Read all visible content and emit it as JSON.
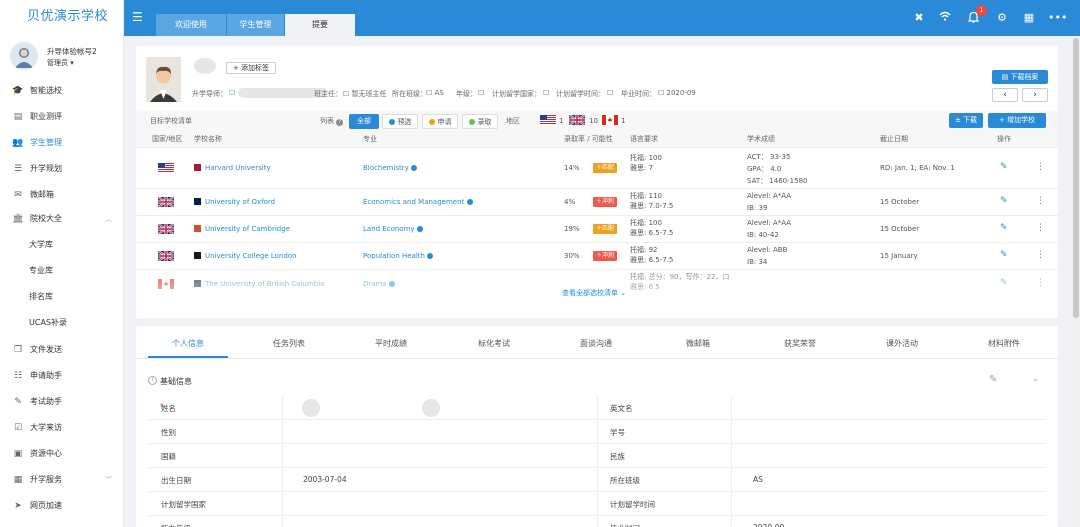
{
  "app": {
    "brand": "贝优演示学校"
  },
  "user": {
    "name": "升导体验帐号2",
    "role": "管理员 ▾"
  },
  "sidebar": {
    "items": [
      {
        "label": "智能选校",
        "icon": "graduation-cap-icon",
        "glyph": "🎓"
      },
      {
        "label": "职业测评",
        "icon": "clipboard-icon",
        "glyph": "▤"
      },
      {
        "label": "学生管理",
        "icon": "users-icon",
        "glyph": "👥"
      },
      {
        "label": "升学规划",
        "icon": "list-icon",
        "glyph": "☰"
      },
      {
        "label": "微邮箱",
        "icon": "mail-icon",
        "glyph": "✉"
      },
      {
        "label": "院校大全",
        "icon": "institution-icon",
        "glyph": "🏛"
      },
      {
        "label": "大学库",
        "icon": "",
        "glyph": ""
      },
      {
        "label": "专业库",
        "icon": "",
        "glyph": ""
      },
      {
        "label": "排名库",
        "icon": "",
        "glyph": ""
      },
      {
        "label": "UCAS补录",
        "icon": "",
        "glyph": ""
      },
      {
        "label": "文件发送",
        "icon": "file-copy-icon",
        "glyph": "❐"
      },
      {
        "label": "申请助手",
        "icon": "list-grid-icon",
        "glyph": "☷"
      },
      {
        "label": "考试助手",
        "icon": "edit-icon",
        "glyph": "✎"
      },
      {
        "label": "大学来访",
        "icon": "calendar-check-icon",
        "glyph": "☑"
      },
      {
        "label": "资源中心",
        "icon": "folder-icon",
        "glyph": "▣"
      },
      {
        "label": "升学服务",
        "icon": "grid-icon",
        "glyph": "▦"
      },
      {
        "label": "网页加速",
        "icon": "send-icon",
        "glyph": "➤"
      }
    ]
  },
  "topbar": {
    "tabs": [
      "欢迎使用",
      "学生管理",
      "提要"
    ],
    "bell_count": "1"
  },
  "profile": {
    "add_tag": "+ 添加标签",
    "download_button": "下载档案",
    "meta": {
      "advisor_label": "升学导师：",
      "teacher_label": "班主任：",
      "teacher_value": "暂无班主任",
      "class_label": "所在班级：",
      "class_value": "AS",
      "grade_label": "年级：",
      "country_label": "计划留学国家：",
      "time_label": "计划留学时间：",
      "grad_label": "毕业时间：",
      "grad_value": "2020-09"
    }
  },
  "schools": {
    "title": "目标学校清单",
    "list_label": "列表",
    "filters": [
      "全部",
      "预选",
      "申请",
      "录取"
    ],
    "filter_colors": [
      "#2a8ad8",
      "#f0a020",
      "#6cc24a"
    ],
    "region_label": "地区",
    "region_counts": [
      "1",
      "10",
      "1"
    ],
    "download": "± 下载",
    "add": "+ 增加学校",
    "headers": [
      "国家/地区",
      "学校名称",
      "专业",
      "录取率 / 可能性",
      "语言要求",
      "学术成绩",
      "截止日期",
      "操作"
    ],
    "rows": [
      {
        "flag": "us",
        "name": "Harvard University",
        "major": "Biochemistry",
        "rate": "14%",
        "chance": "匹配",
        "chance_color": "#f0a020",
        "lang": [
          "托福: 100",
          "雅思: 7"
        ],
        "acad": [
          "ACT： 33-35",
          "GPA： 4.0",
          "SAT： 1460-1580"
        ],
        "deadline": "RD: Jan. 1; EA: Nov. 1"
      },
      {
        "flag": "uk",
        "name": "University of Oxford",
        "major": "Economics and Management",
        "rate": "4%",
        "chance": "冲刺",
        "chance_color": "#f05a4a",
        "lang": [
          "托福: 110",
          "雅思: 7.0-7.5"
        ],
        "acad": [
          "Alevel: A*AA",
          "IB: 39"
        ],
        "deadline": "15 October"
      },
      {
        "flag": "uk",
        "name": "University of Cambridge",
        "major": "Land Economy",
        "rate": "19%",
        "chance": "匹配",
        "chance_color": "#f0a020",
        "lang": [
          "托福: 100",
          "雅思: 6.5-7.5"
        ],
        "acad": [
          "Alevel: A*AA",
          "IB: 40-42"
        ],
        "deadline": "15 October"
      },
      {
        "flag": "uk",
        "name": "University College London",
        "major": "Population Health",
        "rate": "30%",
        "chance": "冲刺",
        "chance_color": "#f05a4a",
        "lang": [
          "托福: 92",
          "雅思: 6.5-7.5"
        ],
        "acad": [
          "Alevel: ABB",
          "IB: 34"
        ],
        "deadline": "15 January"
      },
      {
        "flag": "ca",
        "name": "The University of British Columbia",
        "major": "Drama",
        "rate": "",
        "chance": "",
        "chance_color": "",
        "lang": [
          "托福: 总分：90，写作：22，口",
          "雅思: 6.5"
        ],
        "acad": [
          "",
          ""
        ],
        "deadline": ""
      }
    ],
    "view_all": "查看全部选校清单 ⌄"
  },
  "profile_tabs": [
    "个人信息",
    "任务列表",
    "平时成绩",
    "标化考试",
    "面谈沟通",
    "微邮箱",
    "获奖荣誉",
    "课外活动",
    "材料附件"
  ],
  "basic": {
    "title": "基础信息",
    "fields": [
      {
        "l": "姓名",
        "v": "",
        "r": "英文名",
        "rv": ""
      },
      {
        "l": "性别",
        "v": "",
        "r": "学号",
        "rv": ""
      },
      {
        "l": "国籍",
        "v": "",
        "r": "民族",
        "rv": ""
      },
      {
        "l": "出生日期",
        "v": "2003-07-04",
        "r": "所在班级",
        "rv": "AS"
      },
      {
        "l": "计划留学国家",
        "v": "",
        "r": "计划留学时间",
        "rv": ""
      },
      {
        "l": "所在年级",
        "v": "",
        "r": "毕业时间",
        "rv": "2020-09"
      }
    ]
  }
}
